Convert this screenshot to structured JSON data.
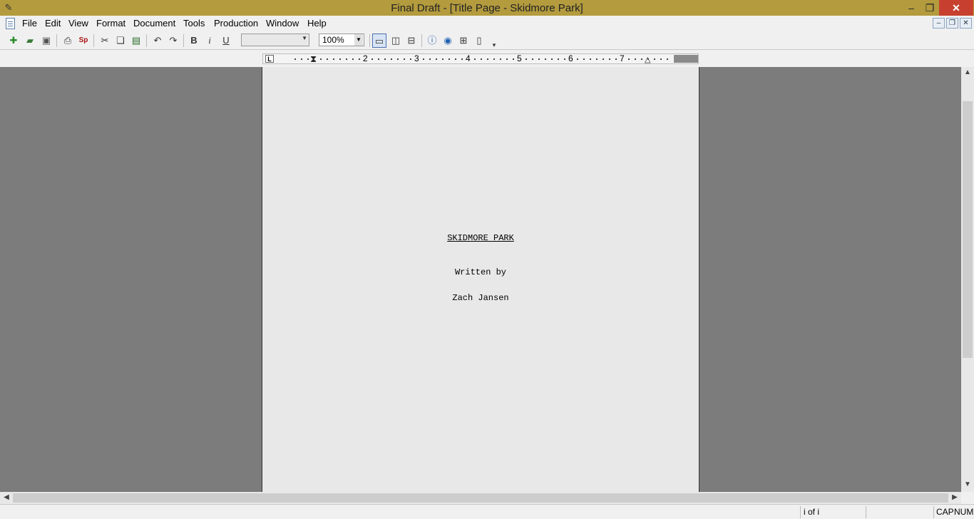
{
  "window": {
    "title": "Final Draft - [Title Page - Skidmore Park]",
    "min_glyph": "–",
    "restore_glyph": "❐",
    "close_glyph": "✕"
  },
  "menu": [
    "File",
    "Edit",
    "View",
    "Format",
    "Document",
    "Tools",
    "Production",
    "Window",
    "Help"
  ],
  "toolbar": {
    "bold_label": "B",
    "italic_label": "i",
    "underline_label": "U",
    "font_value": "",
    "zoom_value": "100%"
  },
  "ruler": {
    "numbers": [
      "2",
      "3",
      "4",
      "5",
      "6",
      "7"
    ],
    "tab_marker": "L"
  },
  "page": {
    "title": "SKIDMORE PARK",
    "written_by": "Written by",
    "author": "Zach Jansen"
  },
  "status": {
    "page_indicator": "i of i",
    "cap": "CAP",
    "num": "NUM"
  },
  "colors": {
    "titlebar": "#b39b3e",
    "close_button": "#c7402f",
    "workspace": "#7c7c7c",
    "page": "#e8e8e8"
  }
}
